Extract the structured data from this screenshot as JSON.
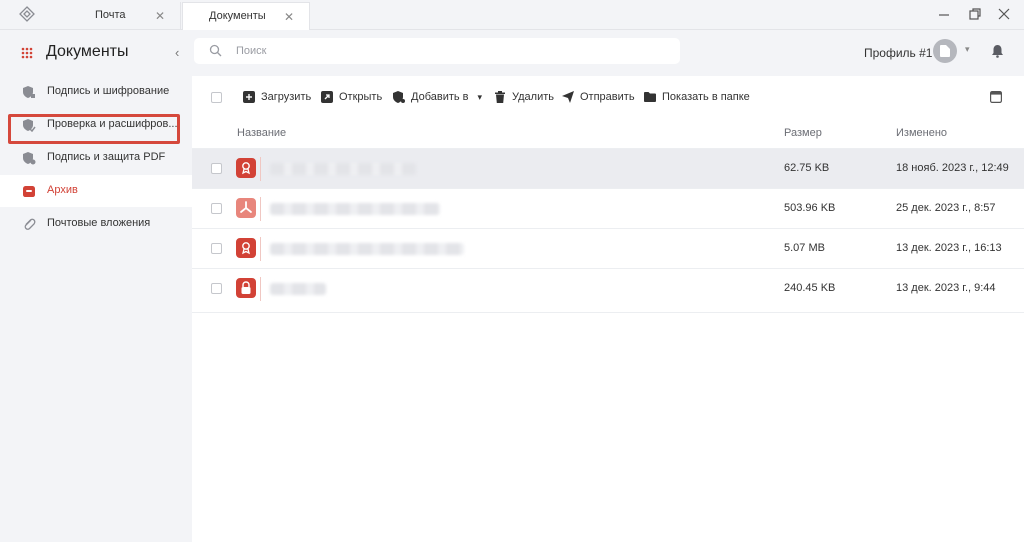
{
  "tabs": [
    {
      "label": "Почта"
    },
    {
      "label": "Документы"
    }
  ],
  "sidebar": {
    "title": "Документы",
    "items": [
      {
        "label": "Подпись и шифрование",
        "icon": "shield-sign-icon"
      },
      {
        "label": "Проверка и расшифров...",
        "icon": "shield-check-icon"
      },
      {
        "label": "Подпись и защита PDF",
        "icon": "shield-pdf-icon"
      },
      {
        "label": "Архив",
        "icon": "archive-icon"
      },
      {
        "label": "Почтовые вложения",
        "icon": "paperclip-icon"
      }
    ]
  },
  "search": {
    "placeholder": "Поиск"
  },
  "profile": {
    "label": "Профиль #1"
  },
  "toolbar": {
    "upload": "Загрузить",
    "open": "Открыть",
    "add_to": "Добавить в",
    "delete": "Удалить",
    "send": "Отправить",
    "show_in_folder": "Показать в папке"
  },
  "table": {
    "columns": {
      "name": "Название",
      "size": "Размер",
      "modified": "Изменено"
    },
    "rows": [
      {
        "size": "62.75 KB",
        "modified": "18 нояб. 2023 г., 12:49",
        "type": "signature-icon"
      },
      {
        "size": "503.96 KB",
        "modified": "25 дек. 2023 г., 8:57",
        "type": "pdf-icon"
      },
      {
        "size": "5.07 MB",
        "modified": "13 дек. 2023 г., 16:13",
        "type": "signature-icon"
      },
      {
        "size": "240.45 KB",
        "modified": "13 дек. 2023 г., 9:44",
        "type": "lock-icon"
      }
    ]
  },
  "colors": {
    "accent": "#d24236",
    "highlight_border": "#d5483c",
    "pdf_light": "#e8867c"
  }
}
